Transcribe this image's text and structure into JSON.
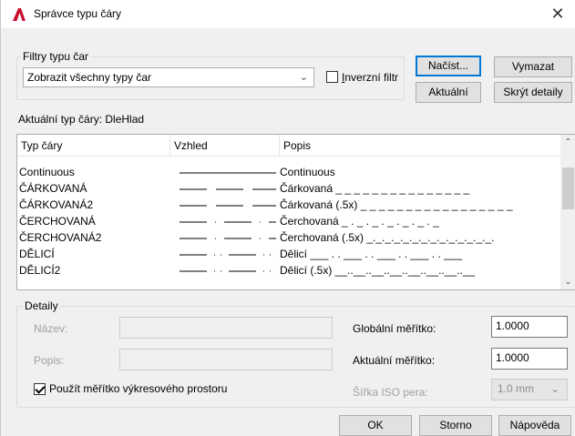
{
  "window": {
    "title": "Správce typu čáry",
    "close_symbol": "✕",
    "accent": "#c8102e"
  },
  "filters": {
    "group_label": "Filtry typu čar",
    "combo_value": "Zobrazit všechny typy čar",
    "invert_label": "Inverzní filtr"
  },
  "buttons": {
    "load": "Načíst...",
    "delete": "Vymazat",
    "current": "Aktuální",
    "hide_details": "Skrýt detaily",
    "ok": "OK",
    "cancel": "Storno",
    "help": "Nápověda"
  },
  "current_linetype": "Aktuální typ čáry:  DleHlad",
  "table": {
    "columns": [
      "Typ čáry",
      "Vzhled",
      "Popis"
    ],
    "rows": [
      {
        "name": "Continuous",
        "description": "Continuous"
      },
      {
        "name": "ČÁRKOVANÁ",
        "description": "Čárkovaná _ _ _ _ _ _ _ _ _ _ _ _ _ _ _"
      },
      {
        "name": "ČÁRKOVANÁ2",
        "description": "Čárkovaná (.5x) _ _ _ _ _ _ _ _ _ _ _ _ _ _ _ _ _"
      },
      {
        "name": "ČERCHOVANÁ",
        "description": "Čerchovaná _ . _ . _ . _ . _ . _ . _"
      },
      {
        "name": "ČERCHOVANÁ2",
        "description": "Čerchovaná (.5x) _._._._._._._._._._._._._._."
      },
      {
        "name": "DĚLICÍ",
        "description": "Dělicí ___ . . ___ . . ___ . . ___ . . ___"
      },
      {
        "name": "DĚLICÍ2",
        "description": "Dělicí (.5x) __..__..__..__..__..__..__..__"
      }
    ]
  },
  "details": {
    "group_label": "Detaily",
    "name_label": "Název:",
    "desc_label": "Popis:",
    "paperspace_label": "Použít měřítko výkresového prostoru",
    "global_scale_label": "Globální měřítko:",
    "global_scale_value": "1.0000",
    "current_scale_label": "Aktuální měřítko:",
    "current_scale_value": "1.0000",
    "iso_pen_label": "Šířka ISO pera:",
    "iso_pen_value": "1.0 mm"
  }
}
